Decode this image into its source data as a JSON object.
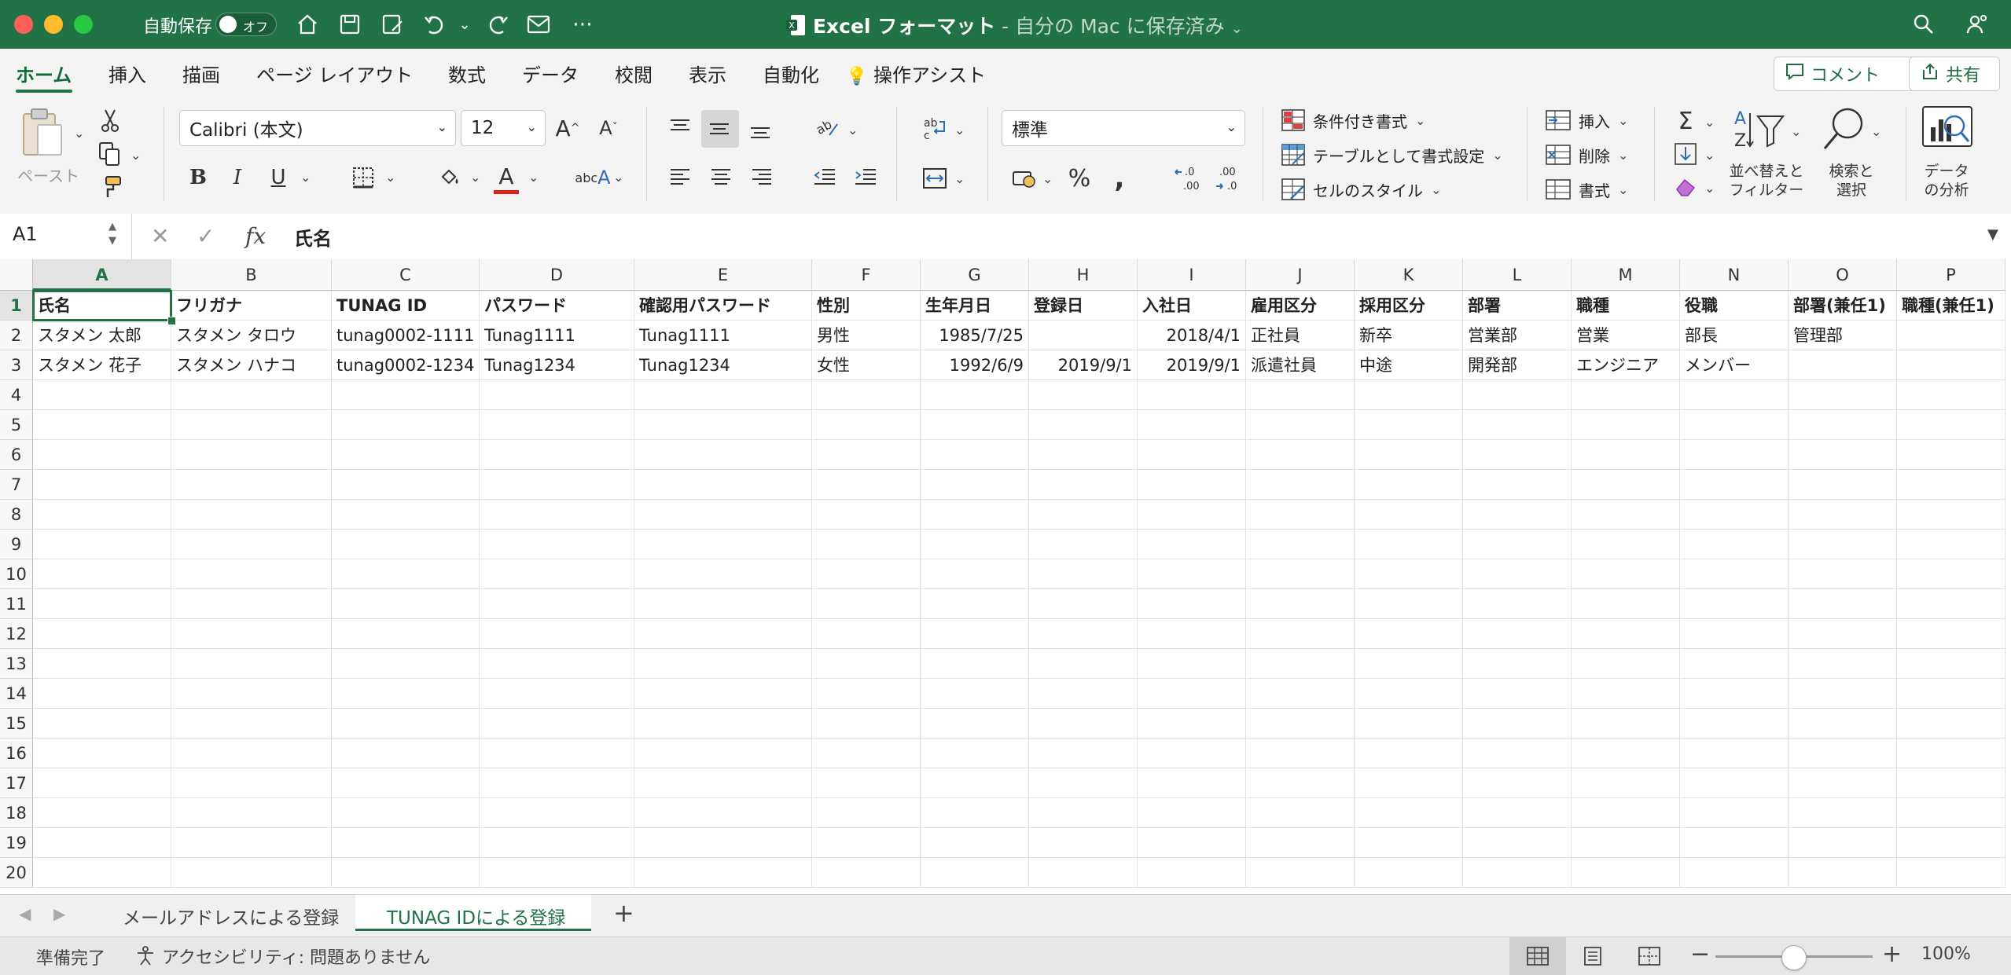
{
  "titlebar": {
    "autosave_label": "自動保存",
    "autosave_state": "オフ",
    "doc_name": "Excel フォーマット",
    "doc_location": " - 自分の Mac に保存済み",
    "colors": {
      "bar": "#217346",
      "close": "#ff5f57",
      "minimize": "#febc2e",
      "zoom": "#28c840"
    },
    "icons": [
      "home-icon",
      "save-icon",
      "save-as-icon",
      "undo-icon",
      "redo-icon",
      "email-icon",
      "more-icon",
      "search-icon",
      "share-person-icon"
    ]
  },
  "ribbon_tabs": [
    "ホーム",
    "挿入",
    "描画",
    "ページ レイアウト",
    "数式",
    "データ",
    "校閲",
    "表示",
    "自動化",
    "操作アシスト"
  ],
  "ribbon_buttons": {
    "comment": "コメント",
    "share": "共有"
  },
  "ribbon": {
    "paste_label": "ペースト",
    "font_name": "Calibri (本文)",
    "font_size": "12",
    "number_format": "標準",
    "styles": {
      "conditional": "条件付き書式",
      "as_table": "テーブルとして書式設定",
      "cell_styles": "セルのスタイル"
    },
    "cells": {
      "insert": "挿入",
      "delete": "削除",
      "format": "書式"
    },
    "sort_filter": "並べ替えと\nフィルター",
    "find_select": "検索と\n選択",
    "analyze": "データ\nの分析"
  },
  "formula_bar": {
    "cell_ref": "A1",
    "fx": "fx",
    "content": "氏名"
  },
  "grid": {
    "columns": [
      "A",
      "B",
      "C",
      "D",
      "E",
      "F",
      "G",
      "H",
      "I",
      "J",
      "K",
      "L",
      "M",
      "N",
      "O",
      "P"
    ],
    "row_numbers": [
      "1",
      "2",
      "3",
      "4",
      "5",
      "6",
      "7",
      "8",
      "9",
      "10",
      "11",
      "12",
      "13",
      "14",
      "15",
      "16",
      "17",
      "18",
      "19",
      "20"
    ],
    "selected_cell": "A1",
    "rows": [
      [
        "氏名",
        "フリガナ",
        "TUNAG ID",
        "パスワード",
        "確認用パスワード",
        "性別",
        "生年月日",
        "登録日",
        "入社日",
        "雇用区分",
        "採用区分",
        "部署",
        "職種",
        "役職",
        "部署(兼任1)",
        "職種(兼任1)"
      ],
      [
        "スタメン 太郎",
        "スタメン タロウ",
        "tunag0002-1111",
        "Tunag1111",
        "Tunag1111",
        "男性",
        "1985/7/25",
        "",
        "2018/4/1",
        "正社員",
        "新卒",
        "営業部",
        "営業",
        "部長",
        "管理部",
        ""
      ],
      [
        "スタメン 花子",
        "スタメン ハナコ",
        "tunag0002-1234",
        "Tunag1234",
        "Tunag1234",
        "女性",
        "1992/6/9",
        "2019/9/1",
        "2019/9/1",
        "派遣社員",
        "中途",
        "開発部",
        "エンジニア",
        "メンバー",
        "",
        ""
      ]
    ]
  },
  "sheet_tabs": [
    "メールアドレスによる登録",
    "TUNAG IDによる登録"
  ],
  "active_sheet": "TUNAG IDによる登録",
  "status": {
    "ready": "準備完了",
    "accessibility": "アクセシビリティ: 問題ありません",
    "zoom": "100%"
  }
}
